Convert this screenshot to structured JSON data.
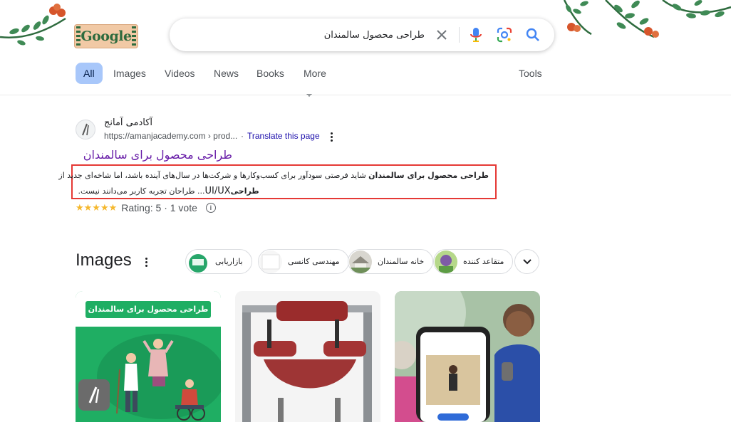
{
  "logo": {
    "text": "Google"
  },
  "search": {
    "query": "طراحی محصول سالمندان",
    "clear_icon": "close-icon",
    "mic_icon": "microphone-icon",
    "lens_icon": "google-lens-icon",
    "search_icon": "search-icon"
  },
  "tabs": [
    {
      "label": "All",
      "active": true
    },
    {
      "label": "Images"
    },
    {
      "label": "Videos"
    },
    {
      "label": "News"
    },
    {
      "label": "Books"
    },
    {
      "label": "More"
    }
  ],
  "tools_label": "Tools",
  "result": {
    "site_name": "آکادمی آمانج",
    "url": "https://amanjacademy.com › prod...",
    "url_separator": "·",
    "translate_label": "Translate this page",
    "title": "طراحی محصول برای سالمندان",
    "snippet_bold": "طراحی محصول برای سالمندان",
    "snippet_line1_rest": " شاید فرصتی سودآور برای کسب‌وکارها و شرکت‌ها در سال‌های آینده باشد، اما شاخه‌ای جدید از",
    "snippet_line2_prefix": "... طراحان تجربه کاربر می‌دانند",
    "snippet_line2_mid": " نیست. ",
    "snippet_line2_ui": "UI/UX",
    "snippet_line2_bold": " طراحی",
    "stars": "★★★★★",
    "rating_text": "Rating: 5 · 1 vote",
    "highlight_color": "#e53935"
  },
  "images_section": {
    "heading": "Images",
    "chips": [
      {
        "label": "بازاریابی"
      },
      {
        "label": "مهندسی کانسی"
      },
      {
        "label": "خانه سالمندان"
      },
      {
        "label": "متقاعد کننده"
      }
    ],
    "next_icon": "chevron-down-icon",
    "card1_title": "طراحی محصول برای سالمندان"
  },
  "colors": {
    "link_visited": "#681da8",
    "link": "#1a0dab",
    "active_tab_bg": "#a8c7fa",
    "star": "#f5b82e"
  }
}
